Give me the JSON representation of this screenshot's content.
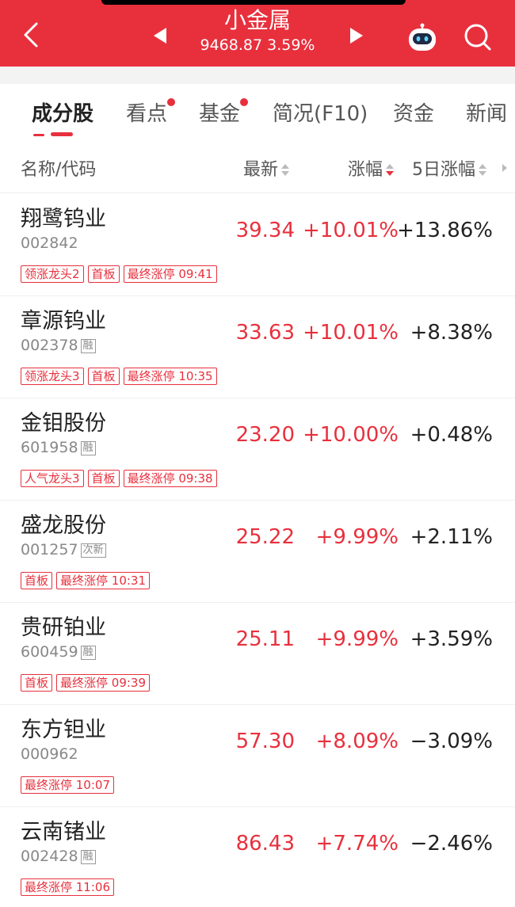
{
  "header": {
    "title": "小金属",
    "index_value": "9468.87",
    "index_change": "3.59%"
  },
  "tabs": [
    {
      "label": "成分股",
      "active": true,
      "dot": false
    },
    {
      "label": "看点",
      "active": false,
      "dot": true
    },
    {
      "label": "基金",
      "active": false,
      "dot": true
    },
    {
      "label": "简况(F10)",
      "active": false,
      "dot": false
    },
    {
      "label": "资金",
      "active": false,
      "dot": false
    },
    {
      "label": "新闻",
      "active": false,
      "dot": false
    }
  ],
  "table": {
    "columns": {
      "name": "名称/代码",
      "latest": "最新",
      "change": "涨幅",
      "change5": "5日涨幅"
    },
    "rows": [
      {
        "name": "翔鹭钨业",
        "code": "002842",
        "badge": "",
        "tags": [
          "领涨龙头2",
          "首板",
          "最终涨停 09:41"
        ],
        "price": "39.34",
        "change": "+10.01%",
        "change5": "+13.86%"
      },
      {
        "name": "章源钨业",
        "code": "002378",
        "badge": "融",
        "tags": [
          "领涨龙头3",
          "首板",
          "最终涨停 10:35"
        ],
        "price": "33.63",
        "change": "+10.01%",
        "change5": "+8.38%"
      },
      {
        "name": "金钼股份",
        "code": "601958",
        "badge": "融",
        "tags": [
          "人气龙头3",
          "首板",
          "最终涨停 09:38"
        ],
        "price": "23.20",
        "change": "+10.00%",
        "change5": "+0.48%"
      },
      {
        "name": "盛龙股份",
        "code": "001257",
        "badge": "次新",
        "tags": [
          "首板",
          "最终涨停 10:31"
        ],
        "price": "25.22",
        "change": "+9.99%",
        "change5": "+2.11%"
      },
      {
        "name": "贵研铂业",
        "code": "600459",
        "badge": "融",
        "tags": [
          "首板",
          "最终涨停 09:39"
        ],
        "price": "25.11",
        "change": "+9.99%",
        "change5": "+3.59%"
      },
      {
        "name": "东方钽业",
        "code": "000962",
        "badge": "",
        "tags": [
          "最终涨停 10:07"
        ],
        "price": "57.30",
        "change": "+8.09%",
        "change5": "−3.09%"
      },
      {
        "name": "云南锗业",
        "code": "002428",
        "badge": "融",
        "tags": [
          "最终涨停 11:06"
        ],
        "price": "86.43",
        "change": "+7.74%",
        "change5": "−2.46%"
      }
    ]
  },
  "colors": {
    "brand_red": "#e8303d",
    "up": "#e8303d",
    "text": "#222222",
    "muted": "#888888"
  },
  "icons": [
    "back-arrow-icon",
    "prev-triangle-icon",
    "next-triangle-icon",
    "robot-assistant-icon",
    "search-icon",
    "sort-icon",
    "sort-desc-icon",
    "more-columns-icon"
  ]
}
